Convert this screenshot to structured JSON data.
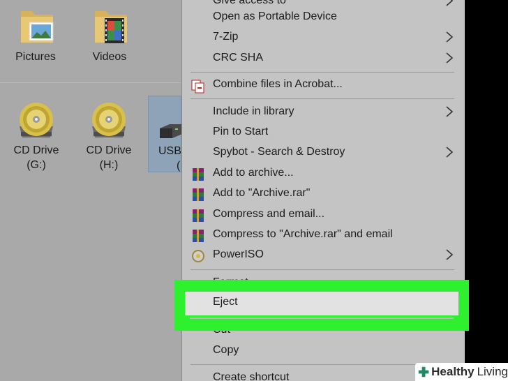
{
  "explorer": {
    "folders": [
      {
        "label": "Pictures",
        "icon": "pictures-folder-icon"
      },
      {
        "label": "Videos",
        "icon": "videos-folder-icon"
      }
    ],
    "drives": [
      {
        "label_line1": "CD Drive",
        "label_line2": "(G:)",
        "icon": "cd-drive-icon"
      },
      {
        "label_line1": "CD Drive",
        "label_line2": "(H:)",
        "icon": "cd-drive-icon"
      },
      {
        "label_line1": "USB",
        "label_line2": "(",
        "icon": "usb-drive-icon",
        "selected": true
      }
    ]
  },
  "context_menu": {
    "items": [
      {
        "label": "Give access to",
        "submenu": true
      },
      {
        "label": "Open as Portable Device",
        "submenu": false
      },
      {
        "label": "7-Zip",
        "submenu": true
      },
      {
        "label": "CRC SHA",
        "submenu": true
      },
      {
        "label": "Combine files in Acrobat...",
        "submenu": false,
        "icon": "acrobat-icon"
      },
      {
        "label": "Include in library",
        "submenu": true
      },
      {
        "label": "Pin to Start",
        "submenu": false
      },
      {
        "label": "Spybot - Search & Destroy",
        "submenu": true
      },
      {
        "label": "Add to archive...",
        "submenu": false,
        "icon": "winrar-icon"
      },
      {
        "label": "Add to \"Archive.rar\"",
        "submenu": false,
        "icon": "winrar-icon"
      },
      {
        "label": "Compress and email...",
        "submenu": false,
        "icon": "winrar-icon"
      },
      {
        "label": "Compress to \"Archive.rar\" and email",
        "submenu": false,
        "icon": "winrar-icon"
      },
      {
        "label": "PowerISO",
        "submenu": true,
        "icon": "poweriso-icon"
      },
      {
        "label": "Format...",
        "submenu": false
      },
      {
        "label": "Eject",
        "submenu": false,
        "highlighted": true
      },
      {
        "label": "Cut",
        "submenu": false
      },
      {
        "label": "Copy",
        "submenu": false
      },
      {
        "label": "Create shortcut",
        "submenu": false
      }
    ]
  },
  "colors": {
    "highlight_frame": "#2ef02e",
    "explorer_bg": "#a9a9a9",
    "menu_bg": "#c4c4c4"
  },
  "watermark": {
    "brand": "Healthy",
    "brand2": "Living"
  }
}
